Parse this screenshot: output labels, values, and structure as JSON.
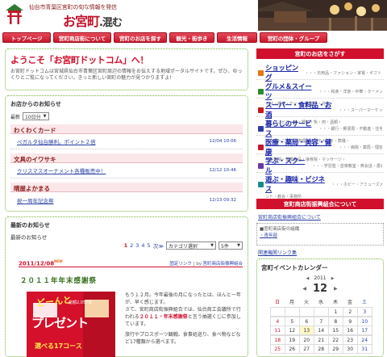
{
  "header": {
    "tagline": "仙台市青葉区宮町の旬な情報を発信",
    "brand_prefix": "お",
    "brand_main": "宮町",
    "brand_suffix": ".混む"
  },
  "nav": [
    {
      "label": "トップページ",
      "w": 60
    },
    {
      "label": "宮町商店街について",
      "w": 72
    },
    {
      "label": "宮町のお店を探す",
      "w": 66
    },
    {
      "label": "観光・街歩き",
      "w": 56
    },
    {
      "label": "生活情報",
      "w": 50
    },
    {
      "label": "宮町の団体・グループ",
      "w": 80
    }
  ],
  "welcome": {
    "title": "ようこそ「お宮町ドットコム」へ！",
    "body": "お宮町ドットコムは宮城県仙台市青葉区宮町周辺の情報をお伝えする地域ポータルサイトです。ぜひ、ゆっくりとご覧になってください。きっと新しい宮町の魅力が見つかりますよ!"
  },
  "shop_news": {
    "title": "お店からのお知らせ",
    "filter_label": "最新",
    "filter_value": "10日分",
    "groups": [
      {
        "shop": "わくわくカード",
        "items": [
          {
            "text": "ペガルタ仙台勝利。ポイント２倍",
            "date": "12/04 10:06"
          }
        ]
      },
      {
        "shop": "文具のイワサキ",
        "items": [
          {
            "text": "クリスマスオーナメント各種販売中！",
            "date": "12/12 10:46"
          }
        ]
      },
      {
        "shop": "晴屋よかまる",
        "items": [
          {
            "text": "祝一周年記念祭",
            "date": "12/13 09:32"
          }
        ]
      }
    ]
  },
  "latest_news": {
    "title": "最新のお知らせ",
    "subtitle": "最新のお知らせ",
    "pages": [
      "1",
      "2",
      "3",
      "4",
      "5"
    ],
    "next_label": "次≫",
    "category_select": "カテゴリ選択",
    "count_select": "5件",
    "article": {
      "date": "2011/12/08",
      "new_badge": "NEW",
      "permalink": "固定リンク",
      "by_prefix": " | by:",
      "author": "宮町商店街振興組合",
      "title": "２０１１年年末感謝祭",
      "image_text_1": "どーんと",
      "image_text_2": "プレゼント",
      "image_text_3": "総額2,057本",
      "image_text_4": "選べる17コース",
      "body_1": "もう１２月。今年最後の月になったとは、ほんとー年が、早く感じます。",
      "body_2": "さて、宮町商店街振興組合では、仙台商工会議所で行われる",
      "body_hl": "２０１１・年末感謝祭",
      "body_3": "と言う抽選くじに参加しています。",
      "body_4": "旅行やプロスポーツ観戦、食事処巡り、食べ物などなど17種類から選べます。"
    }
  },
  "search_shops": {
    "title": "宮町のお店をさがす",
    "categories": [
      {
        "name": "ショッピング",
        "tail": "・・・日用品・ファション・家電・ギフト・",
        "desc": "",
        "color": "#e07a10"
      },
      {
        "name": "グルメ＆スイーツ",
        "tail": "・・・和食・洋食・中華・ラーメン",
        "desc": "そば・喫茶・ケーキ・和菓子・弁当・",
        "color": "#2f8a2f"
      },
      {
        "name": "スーパー・食料品・お酒",
        "tail": "・・・スーパーマーケッ",
        "desc": "ト・コンビニ・米・野菜・魚・肉・酒類・",
        "color": "#c81a1a"
      },
      {
        "name": "暮らしのサービス",
        "tail": "・・・銀行・郵便局・不動産・住宅",
        "desc": "・クリーニング・修理・メンテナンス・葬儀・",
        "color": "#2a3fa6"
      },
      {
        "name": "医療・薬局・美容・健康",
        "tail": "・・・病院・薬局・理容",
        "desc": "・美容院・健康食品・接骨院・マッサージ・",
        "color": "#c8172c"
      },
      {
        "name": "学ぶ・スクール",
        "tail": "・・・学習塾・音楽教室・英会話・書道",
        "desc": "",
        "color": "#6a3aa8"
      },
      {
        "name": "遊ぶ・趣味・ビジネス",
        "tail": "・・・ホビー・アミューズメ",
        "desc": "ント・教会・事務所",
        "color": "#1a8a8a"
      }
    ]
  },
  "association": {
    "button": "宮町商店街振興組合について",
    "link": "宮町商店街振興組合について",
    "box_label": "■宮町商店街の組織",
    "box_link": "・青年部",
    "related": "関連機関リンク集"
  },
  "calendar": {
    "title": "宮町イベントカレンダー",
    "prev_year": "◀",
    "next_year": "▶",
    "year": "2011",
    "prev_month": "◀",
    "next_month": "▶",
    "month": "12",
    "weekdays": [
      "日",
      "月",
      "火",
      "水",
      "木",
      "金",
      "土"
    ],
    "rows": [
      [
        "",
        "",
        "",
        "",
        "1",
        "2",
        "3"
      ],
      [
        "4",
        "5",
        "6",
        "7",
        "8",
        "9",
        "10"
      ],
      [
        "11",
        "12",
        "13",
        "14",
        "15",
        "16",
        "17"
      ],
      [
        "18",
        "19",
        "20",
        "21",
        "22",
        "23",
        "24"
      ],
      [
        "25",
        "26",
        "27",
        "28",
        "29",
        "30",
        "31"
      ]
    ],
    "today": "13"
  }
}
